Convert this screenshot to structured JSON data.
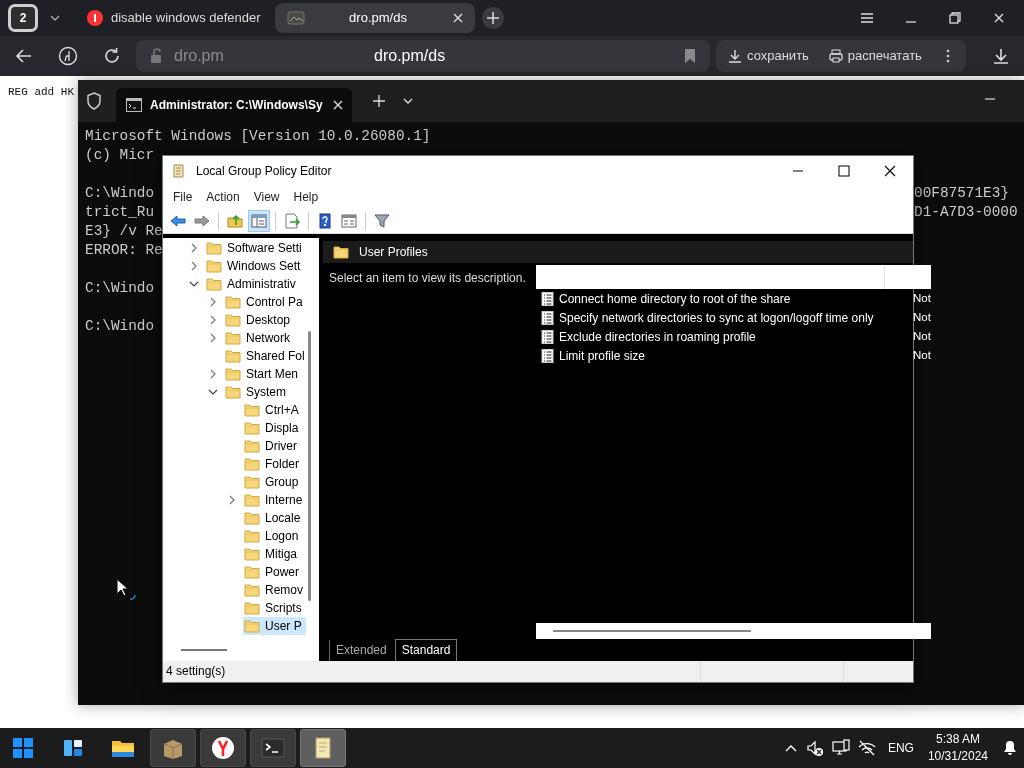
{
  "browser": {
    "tab_count": "2",
    "tabs": [
      {
        "title": "disable windows defender",
        "selected": false
      },
      {
        "title": "dro.pm/ds",
        "selected": true
      }
    ],
    "address": {
      "domain": "dro.pm",
      "url": "dro.pm/ds"
    },
    "actions": [
      "сохранить",
      "распечатать"
    ]
  },
  "page": {
    "text": "REG add HK"
  },
  "terminal": {
    "tab_title": "Administrator: C:\\Windows\\Sy",
    "lines": [
      {
        "kind": "text",
        "left": "Microsoft Windows [Version 10.0.26080.1]"
      },
      {
        "kind": "text",
        "left": "(c) Micr"
      },
      {
        "kind": "blank"
      },
      {
        "kind": "text",
        "left": "C:\\Windo",
        "right": "00F87571E3}"
      },
      {
        "kind": "text",
        "left": "trict_Ru",
        "right": "D1-A7D3-0000"
      },
      {
        "kind": "text",
        "left": "E3} /v Re"
      },
      {
        "kind": "text",
        "left": "ERROR: Re"
      },
      {
        "kind": "blank"
      },
      {
        "kind": "text",
        "left": "C:\\Windo"
      },
      {
        "kind": "blank"
      },
      {
        "kind": "text",
        "left": "C:\\Windo"
      }
    ]
  },
  "gpe": {
    "title": "Local Group Policy Editor",
    "menu": [
      "File",
      "Action",
      "View",
      "Help"
    ],
    "toolbar": [
      {
        "kind": "back",
        "selected": false
      },
      {
        "kind": "forward",
        "selected": false
      },
      {
        "kind": "separator"
      },
      {
        "kind": "up",
        "selected": false
      },
      {
        "kind": "tree",
        "selected": true
      },
      {
        "kind": "separator"
      },
      {
        "kind": "export",
        "selected": false
      },
      {
        "kind": "separator"
      },
      {
        "kind": "help",
        "selected": false
      },
      {
        "kind": "properties",
        "selected": false
      },
      {
        "kind": "separator"
      },
      {
        "kind": "filter",
        "selected": false
      }
    ],
    "tree": [
      {
        "label": "Software Setti",
        "kind": "branch",
        "expanded": false,
        "selected": false
      },
      {
        "label": "Windows Sett",
        "kind": "branch",
        "expanded": false,
        "selected": false
      },
      {
        "label": "Administrativ",
        "kind": "branch",
        "expanded": true,
        "selected": false,
        "children": [
          {
            "label": "Control Pa",
            "kind": "branch",
            "expanded": false,
            "selected": false
          },
          {
            "label": "Desktop",
            "kind": "branch",
            "expanded": false,
            "selected": false
          },
          {
            "label": "Network",
            "kind": "branch",
            "expanded": false,
            "selected": false
          },
          {
            "label": "Shared Fol",
            "kind": "leaf",
            "selected": false
          },
          {
            "label": "Start Men",
            "kind": "branch",
            "expanded": false,
            "selected": false
          },
          {
            "label": "System",
            "kind": "branch",
            "expanded": true,
            "selected": false,
            "children": [
              {
                "label": "Ctrl+A",
                "kind": "leaf",
                "selected": false
              },
              {
                "label": "Displa",
                "kind": "leaf",
                "selected": false
              },
              {
                "label": "Driver",
                "kind": "leaf",
                "selected": false
              },
              {
                "label": "Folder",
                "kind": "leaf",
                "selected": false
              },
              {
                "label": "Group",
                "kind": "leaf",
                "selected": false
              },
              {
                "label": "Interne",
                "kind": "branch",
                "expanded": false,
                "selected": false
              },
              {
                "label": "Locale",
                "kind": "leaf",
                "selected": false
              },
              {
                "label": "Logon",
                "kind": "leaf",
                "selected": false
              },
              {
                "label": "Mitiga",
                "kind": "leaf",
                "selected": false
              },
              {
                "label": "Power",
                "kind": "leaf",
                "selected": false
              },
              {
                "label": "Remov",
                "kind": "leaf",
                "selected": false
              },
              {
                "label": "Scripts",
                "kind": "leaf",
                "selected": false
              },
              {
                "label": "User P",
                "kind": "leaf",
                "selected": true
              }
            ]
          }
        ]
      }
    ],
    "header": "User Profiles",
    "description": "Select an item to view its description.",
    "settings": [
      {
        "name": "Connect home directory to root of the share",
        "column_2": "Not"
      },
      {
        "name": "Specify network directories to sync at logon/logoff time only",
        "column_2": "Not"
      },
      {
        "name": "Exclude directories in roaming profile",
        "column_2": "Not"
      },
      {
        "name": "Limit profile size",
        "column_2": "Not"
      }
    ],
    "view_tabs": [
      {
        "label": "Extended",
        "selected": false
      },
      {
        "label": "Standard",
        "selected": true
      }
    ],
    "status": "4 setting(s)"
  },
  "taskbar": {
    "apps": [
      {
        "kind": "start",
        "open": false,
        "selected": false
      },
      {
        "kind": "widgets",
        "open": false,
        "selected": false
      },
      {
        "kind": "files",
        "open": false,
        "selected": false
      },
      {
        "kind": "package",
        "open": true,
        "selected": false
      },
      {
        "kind": "browser",
        "open": true,
        "selected": false
      },
      {
        "kind": "terminal",
        "open": true,
        "selected": false
      },
      {
        "kind": "policy",
        "open": true,
        "selected": true
      }
    ],
    "language": "ENG",
    "time": "5:38 AM",
    "date": "10/31/2024"
  }
}
